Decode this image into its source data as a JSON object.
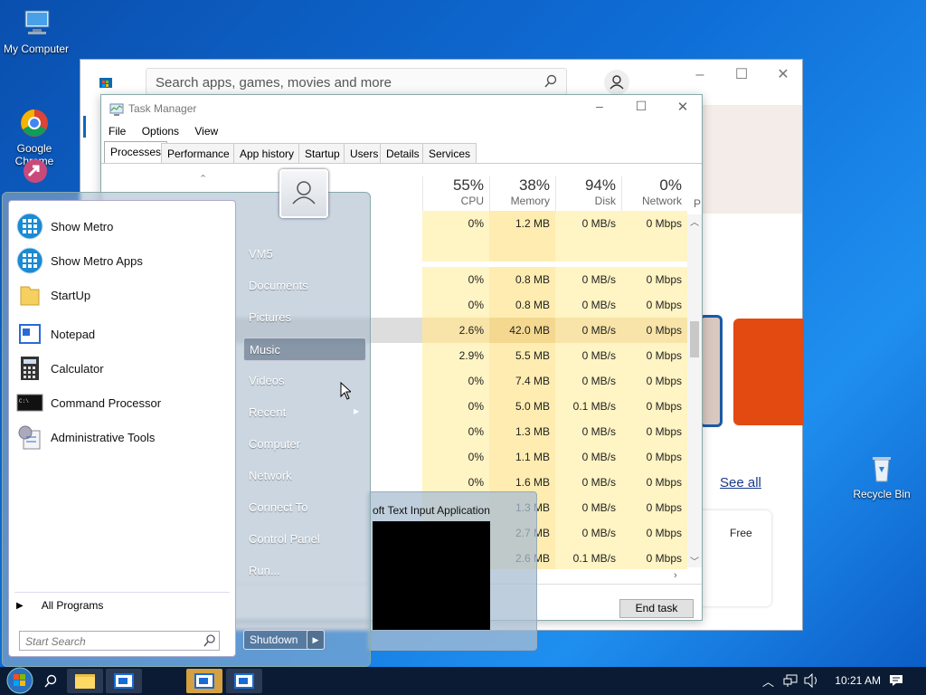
{
  "desktop": {
    "icons": [
      {
        "label": "My Computer",
        "icon": "computer-icon"
      },
      {
        "label": "Google\nChrome",
        "icon": "chrome-icon"
      },
      {
        "label": "Recycle Bin",
        "icon": "recycle-bin-icon"
      }
    ]
  },
  "store": {
    "search_placeholder": "Search apps, games, movies and more",
    "see_all": "See all",
    "free": "Free",
    "accent": "#e24a12"
  },
  "task_manager": {
    "title": "Task Manager",
    "menu": [
      "File",
      "Options",
      "View"
    ],
    "tabs": [
      "Processes",
      "Performance",
      "App history",
      "Startup",
      "Users",
      "Details",
      "Services"
    ],
    "columns": [
      {
        "pct": "55%",
        "label": "CPU"
      },
      {
        "pct": "38%",
        "label": "Memory"
      },
      {
        "pct": "94%",
        "label": "Disk"
      },
      {
        "pct": "0%",
        "label": "Network"
      }
    ],
    "col_p": "P",
    "rows": [
      {
        "cpu": "0%",
        "mem": "1.2 MB",
        "disk": "0 MB/s",
        "net": "0 Mbps"
      },
      {
        "cpu": "",
        "mem": "",
        "disk": "",
        "net": ""
      },
      {
        "cpu": "0%",
        "mem": "0.8 MB",
        "disk": "0 MB/s",
        "net": "0 Mbps"
      },
      {
        "cpu": "0%",
        "mem": "0.8 MB",
        "disk": "0 MB/s",
        "net": "0 Mbps"
      },
      {
        "cpu": "2.6%",
        "mem": "42.0 MB",
        "disk": "0 MB/s",
        "net": "0 Mbps"
      },
      {
        "cpu": "2.9%",
        "mem": "5.5 MB",
        "disk": "0 MB/s",
        "net": "0 Mbps"
      },
      {
        "cpu": "0%",
        "mem": "7.4 MB",
        "disk": "0 MB/s",
        "net": "0 Mbps"
      },
      {
        "cpu": "0%",
        "mem": "5.0 MB",
        "disk": "0.1 MB/s",
        "net": "0 Mbps"
      },
      {
        "cpu": "0%",
        "mem": "1.3 MB",
        "disk": "0 MB/s",
        "net": "0 Mbps"
      },
      {
        "cpu": "0%",
        "mem": "1.1 MB",
        "disk": "0 MB/s",
        "net": "0 Mbps"
      },
      {
        "cpu": "0%",
        "mem": "1.6 MB",
        "disk": "0 MB/s",
        "net": "0 Mbps"
      },
      {
        "cpu": "",
        "mem": "1.3 MB",
        "disk": "0 MB/s",
        "net": "0 Mbps"
      },
      {
        "cpu": "",
        "mem": "2.7 MB",
        "disk": "0 MB/s",
        "net": "0 Mbps"
      },
      {
        "cpu": "",
        "mem": "2.6 MB",
        "disk": "0.1 MB/s",
        "net": "0 Mbps"
      }
    ],
    "end_task": "End task"
  },
  "thumbnail": {
    "title": "oft Text Input Application"
  },
  "start_menu": {
    "left_items": [
      {
        "label": "Show Metro",
        "icon": "metro-icon"
      },
      {
        "label": "Show Metro Apps",
        "icon": "metro-apps-icon"
      },
      {
        "label": "StartUp",
        "icon": "folder-icon"
      },
      {
        "label": "Notepad",
        "icon": "notepad-icon"
      },
      {
        "label": "Calculator",
        "icon": "calculator-icon"
      },
      {
        "label": "Command Processor",
        "icon": "cmd-icon"
      },
      {
        "label": "Administrative Tools",
        "icon": "admin-tools-icon"
      }
    ],
    "all_programs": "All Programs",
    "search_placeholder": "Start Search",
    "right_items": [
      "VM5",
      "Documents",
      "Pictures",
      "Music",
      "Videos",
      "Recent",
      "Computer",
      "Network",
      "Connect To",
      "Control Panel",
      "Run..."
    ],
    "shutdown": "Shutdown"
  },
  "taskbar": {
    "time": "10:21 AM"
  }
}
